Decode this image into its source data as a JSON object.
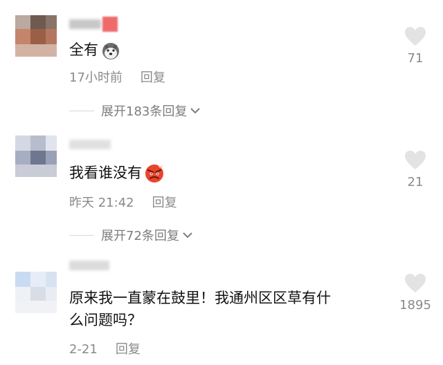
{
  "comments": [
    {
      "text": "全有",
      "emoji": "husky-dog-emoji",
      "time": "17小时前",
      "reply_label": "回复",
      "expand_label": "展开183条回复",
      "like_count": "71"
    },
    {
      "text": "我看谁没有",
      "emoji": "angry-face-emoji",
      "time": "昨天 21:42",
      "reply_label": "回复",
      "expand_label": "展开72条回复",
      "like_count": "21"
    },
    {
      "text_line1": "原来我一直蒙在鼓里！我通州区区草有什",
      "text_line2": "么问题吗？",
      "time": "2-21",
      "reply_label": "回复",
      "like_count": "1895"
    }
  ],
  "colors": {
    "meta_gray": "#8a8a8a",
    "heart_gray": "#e3e3e3",
    "angry_red": "#e8452c"
  }
}
